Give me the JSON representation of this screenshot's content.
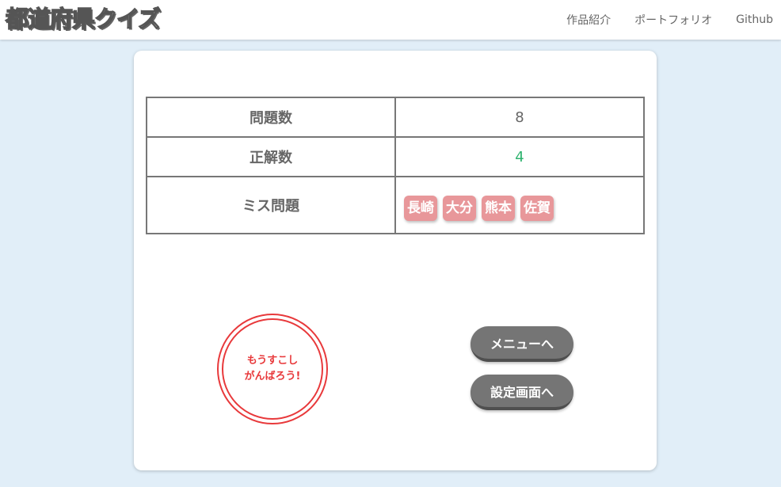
{
  "header": {
    "logo": {
      "part1": "都",
      "accent": "道",
      "part2": "府県クイズ"
    },
    "nav": [
      "作品紹介",
      "ポートフォリオ",
      "Github"
    ]
  },
  "result": {
    "question_count_label": "問題数",
    "question_count": "8",
    "correct_count_label": "正解数",
    "correct_count": "4",
    "missed_label": "ミス問題",
    "missed": [
      "長崎",
      "大分",
      "熊本",
      "佐賀"
    ]
  },
  "stamp": {
    "line1": "もうすこし",
    "line2": "がんばろう!"
  },
  "buttons": {
    "menu": "メニューへ",
    "settings": "設定画面へ"
  },
  "colors": {
    "background": "#e1eef8",
    "correct": "#2fb36f",
    "chip": "#e8979a",
    "stamp": "#e8393b",
    "button": "#757575",
    "logo_accent": "#f0a32a"
  }
}
